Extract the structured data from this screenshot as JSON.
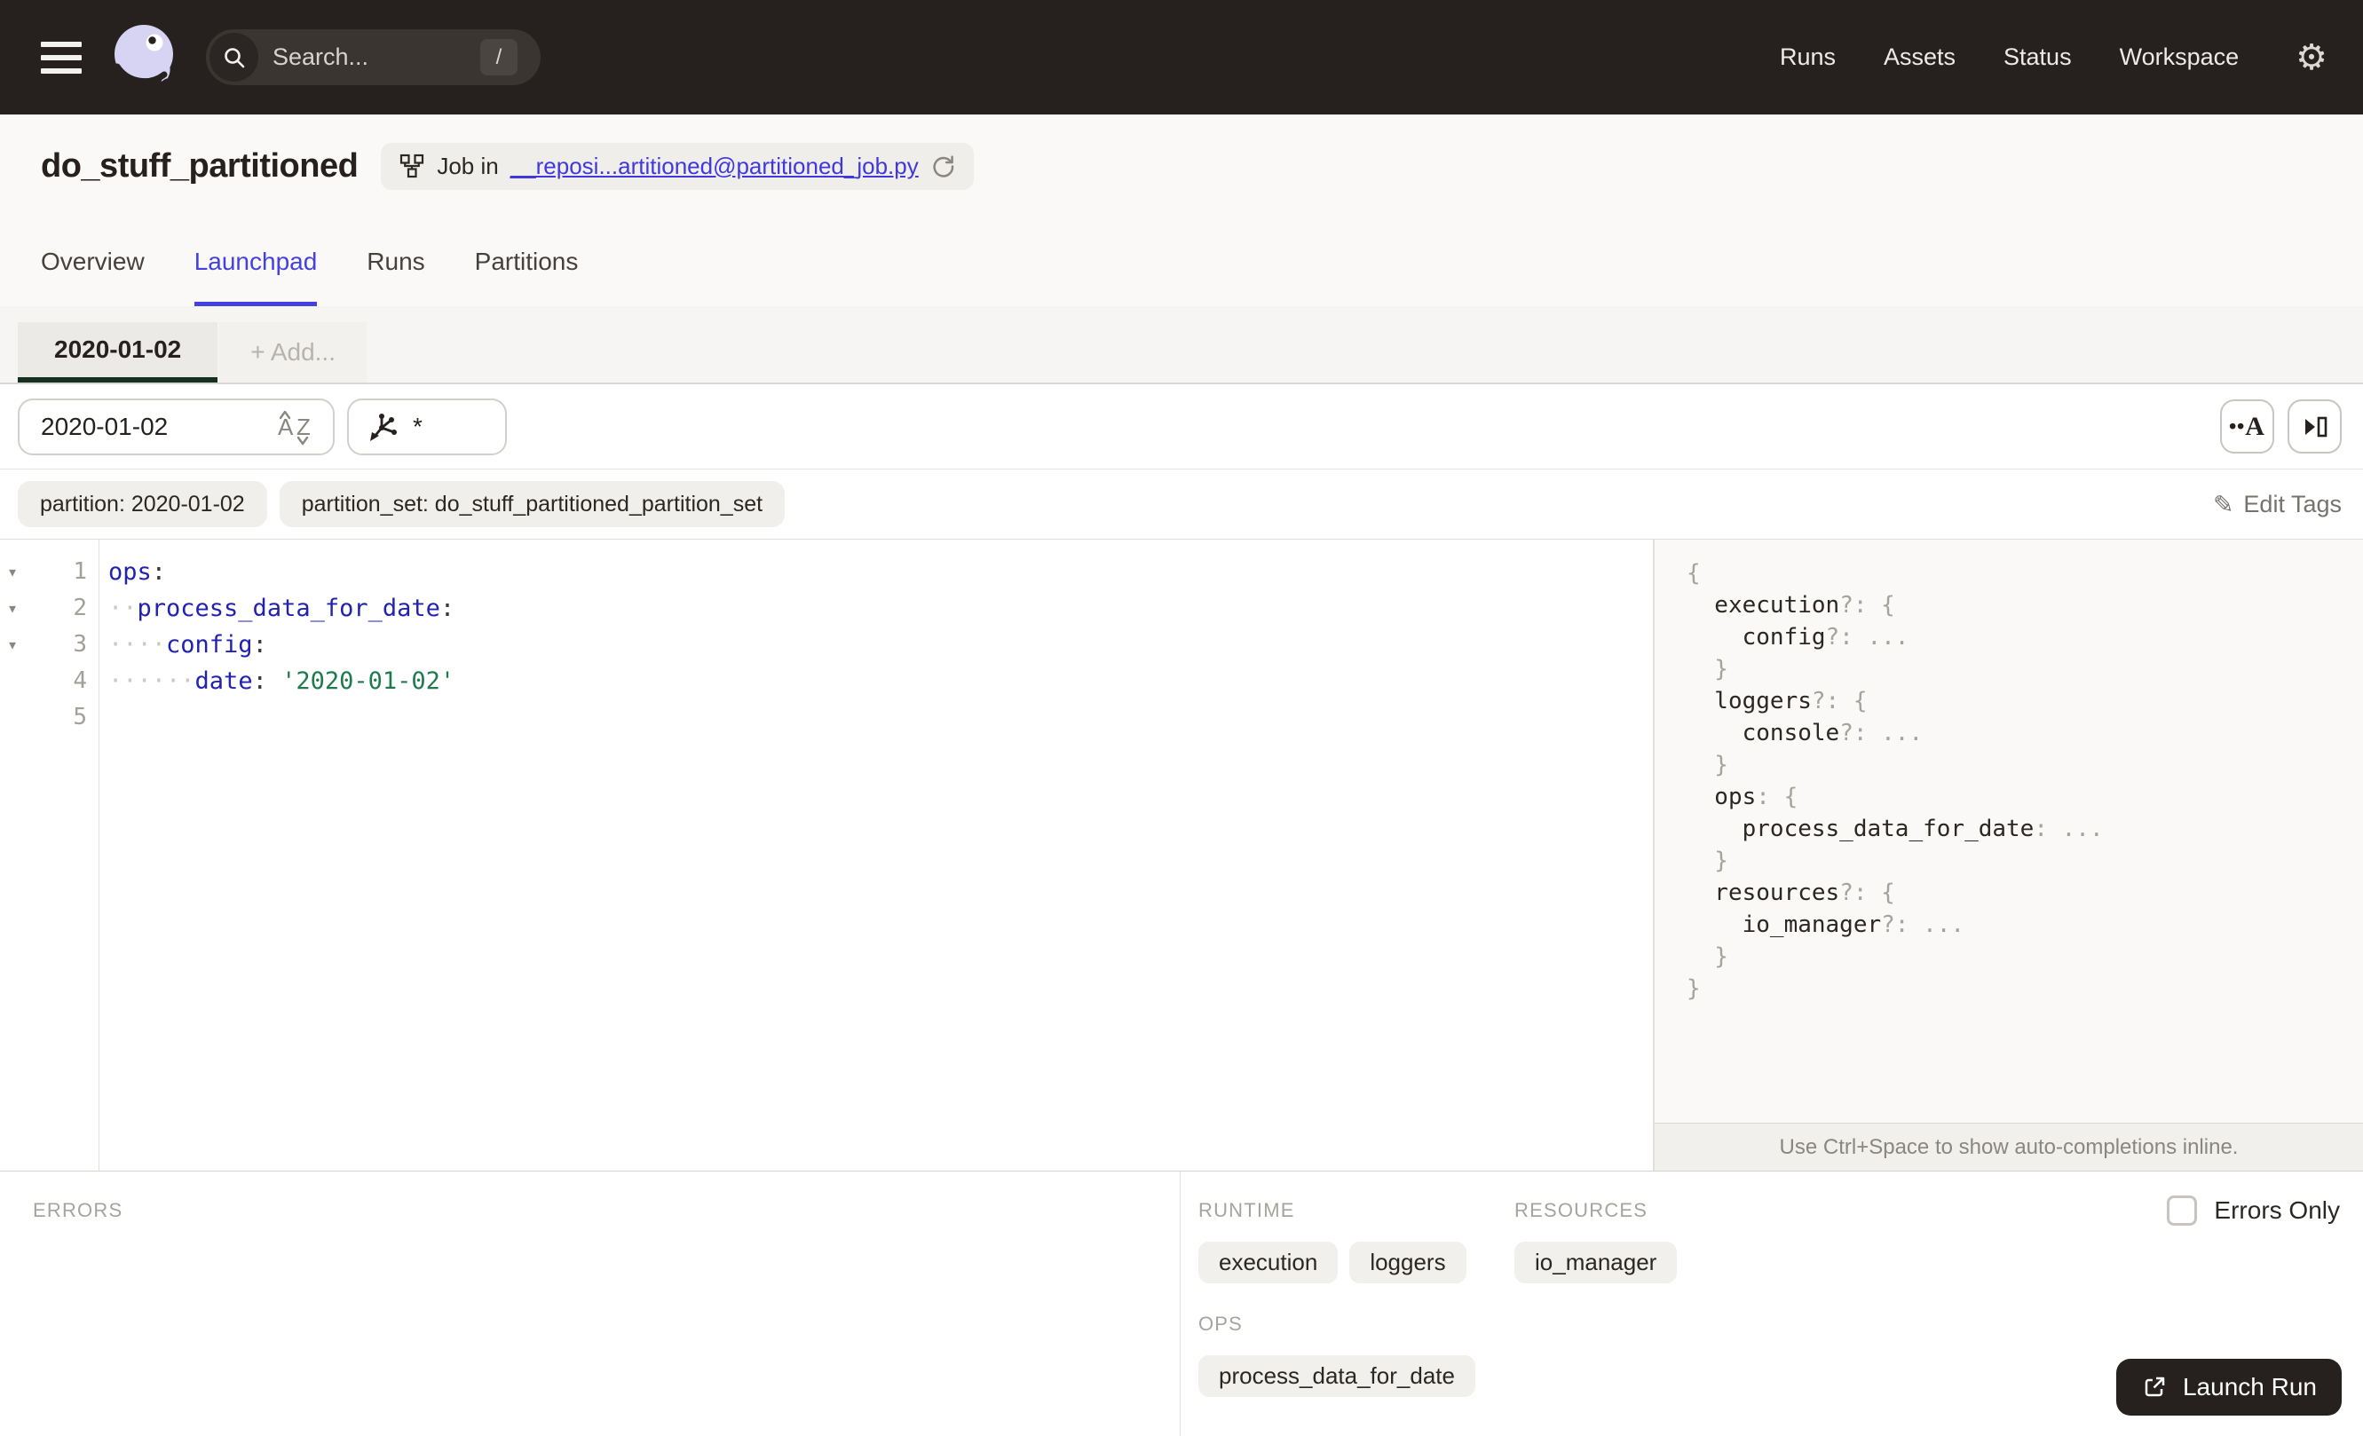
{
  "colors": {
    "nav_bg": "#26211e",
    "accent": "#4441e0",
    "link": "#4038dd",
    "logo_lavender": "#d7d3f3",
    "partition_underline": "#16301f",
    "code_key": "#2222b0",
    "code_string": "#1f7a4d",
    "dark_button": "#26211e"
  },
  "icons": {
    "gear": "⚙",
    "pencil": "✎",
    "fold_arrow": "▾",
    "whitespace_dot": "·"
  },
  "topnav": {
    "search_placeholder": "Search...",
    "search_shortcut": "/",
    "links": [
      "Runs",
      "Assets",
      "Status",
      "Workspace"
    ]
  },
  "header": {
    "title": "do_stuff_partitioned",
    "badge_prefix": "Job in",
    "badge_link": "__reposi...artitioned@partitioned_job.py"
  },
  "tabs": {
    "items": [
      "Overview",
      "Launchpad",
      "Runs",
      "Partitions"
    ],
    "active": "Launchpad"
  },
  "partition_tabs": {
    "active": "2020-01-02",
    "add_label": "+ Add..."
  },
  "toolbar": {
    "partition_value": "2020-01-02",
    "op_selector_value": "*",
    "whitespace_toggle_dots": "••",
    "whitespace_toggle_letter": "A"
  },
  "tags": {
    "items": [
      "partition: 2020-01-02",
      "partition_set: do_stuff_partitioned_partition_set"
    ],
    "edit_label": "Edit Tags"
  },
  "editor": {
    "lines": [
      {
        "num": "1",
        "fold": true,
        "tokens": [
          [
            "k",
            "ops"
          ],
          [
            "p",
            ":"
          ]
        ]
      },
      {
        "num": "2",
        "fold": true,
        "tokens": [
          [
            "w",
            2
          ],
          [
            "k",
            "process_data_for_date"
          ],
          [
            "p",
            ":"
          ]
        ]
      },
      {
        "num": "3",
        "fold": true,
        "tokens": [
          [
            "w",
            4
          ],
          [
            "k",
            "config"
          ],
          [
            "p",
            ":"
          ]
        ]
      },
      {
        "num": "4",
        "fold": false,
        "tokens": [
          [
            "w",
            6
          ],
          [
            "k",
            "date"
          ],
          [
            "p",
            ":"
          ],
          [
            "x",
            " "
          ],
          [
            "s",
            "'2020-01-02'"
          ]
        ]
      },
      {
        "num": "5",
        "fold": false,
        "tokens": []
      }
    ]
  },
  "schema": {
    "lines": [
      {
        "indent": 0,
        "tokens": [
          [
            "p",
            "{"
          ]
        ]
      },
      {
        "indent": 2,
        "tokens": [
          [
            "k",
            "execution"
          ],
          [
            "p",
            "?: {"
          ]
        ]
      },
      {
        "indent": 4,
        "tokens": [
          [
            "k",
            "config"
          ],
          [
            "p",
            "?: ..."
          ]
        ]
      },
      {
        "indent": 2,
        "tokens": [
          [
            "p",
            "}"
          ]
        ]
      },
      {
        "indent": 2,
        "tokens": [
          [
            "k",
            "loggers"
          ],
          [
            "p",
            "?: {"
          ]
        ]
      },
      {
        "indent": 4,
        "tokens": [
          [
            "k",
            "console"
          ],
          [
            "p",
            "?: ..."
          ]
        ]
      },
      {
        "indent": 2,
        "tokens": [
          [
            "p",
            "}"
          ]
        ]
      },
      {
        "indent": 2,
        "tokens": [
          [
            "k",
            "ops"
          ],
          [
            "p",
            ": {"
          ]
        ]
      },
      {
        "indent": 4,
        "tokens": [
          [
            "k",
            "process_data_for_date"
          ],
          [
            "p",
            ": ..."
          ]
        ]
      },
      {
        "indent": 2,
        "tokens": [
          [
            "p",
            "}"
          ]
        ]
      },
      {
        "indent": 2,
        "tokens": [
          [
            "k",
            "resources"
          ],
          [
            "p",
            "?: {"
          ]
        ]
      },
      {
        "indent": 4,
        "tokens": [
          [
            "k",
            "io_manager"
          ],
          [
            "p",
            "?: ..."
          ]
        ]
      },
      {
        "indent": 2,
        "tokens": [
          [
            "p",
            "}"
          ]
        ]
      },
      {
        "indent": 0,
        "tokens": [
          [
            "p",
            "}"
          ]
        ]
      }
    ],
    "hint": "Use Ctrl+Space to show auto-completions inline."
  },
  "bottom": {
    "errors_label": "ERRORS",
    "rows": [
      [
        {
          "label": "RUNTIME",
          "pills": [
            "execution",
            "loggers"
          ]
        },
        {
          "label": "RESOURCES",
          "pills": [
            "io_manager"
          ]
        }
      ],
      [
        {
          "label": "OPS",
          "pills": [
            "process_data_for_date"
          ]
        }
      ]
    ],
    "errors_only_label": "Errors Only",
    "launch_label": "Launch Run"
  }
}
